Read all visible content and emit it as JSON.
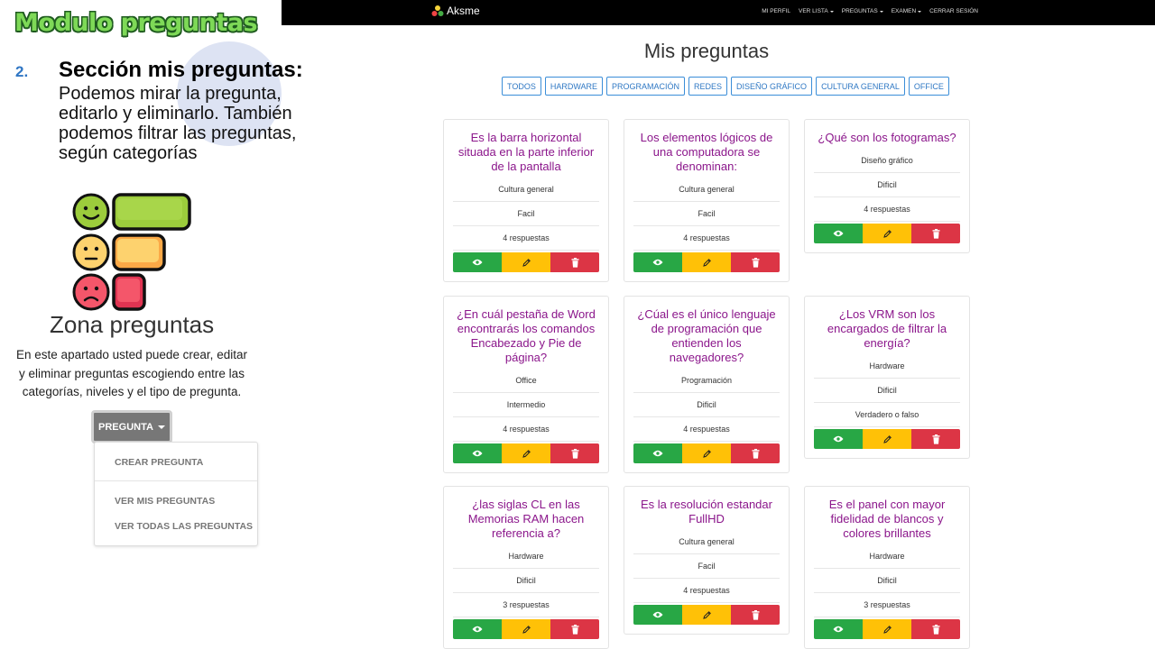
{
  "slide": {
    "title": "Modulo preguntas",
    "section_number": "2.",
    "section_heading": "Sección mis preguntas:",
    "section_description": "Podemos mirar la pregunta, editarlo y eliminarlo. También podemos filtrar las preguntas, según categorías"
  },
  "zona": {
    "title": "Zona preguntas",
    "description": "En este apartado usted puede crear, editar y eliminar preguntas escogiendo entre las categorías, niveles y el tipo de pregunta.",
    "button_label": "PREGUNTA",
    "menu": [
      "CREAR PREGUNTA",
      "VER MIS PREGUNTAS",
      "VER TODAS LAS PREGUNTAS"
    ]
  },
  "navbar": {
    "brand": "Aksme",
    "items": [
      "MI PERFIL",
      "VER LISTA",
      "PREGUNTAS",
      "EXAMEN",
      "CERRAR SESIÓN"
    ]
  },
  "page": {
    "title": "Mis preguntas",
    "filters": [
      "TODOS",
      "HARDWARE",
      "PROGRAMACIÓN",
      "REDES",
      "DISEÑO GRÁFICO",
      "CULTURA GENERAL",
      "OFFICE"
    ]
  },
  "cards": [
    {
      "question": "Es la barra horizontal situada en la parte inferior de la pantalla",
      "category": "Cultura general",
      "level": "Facil",
      "extra": "4 respuestas"
    },
    {
      "question": "Los elementos lógicos de una computadora se denominan:",
      "category": "Cultura general",
      "level": "Facil",
      "extra": "4 respuestas"
    },
    {
      "question": "¿Qué son los fotogramas?",
      "category": "Diseño gráfico",
      "level": "Dificil",
      "extra": "4 respuestas"
    },
    {
      "question": "¿En cuál pestaña de Word encontrarás los comandos Encabezado y Pie de página?",
      "category": "Office",
      "level": "Intermedio",
      "extra": "4 respuestas"
    },
    {
      "question": "¿Cúal es el único lenguaje de programación que entienden los navegadores?",
      "category": "Programación",
      "level": "Dificil",
      "extra": "4 respuestas"
    },
    {
      "question": "¿Los VRM son los encargados de filtrar la energía?",
      "category": "Hardware",
      "level": "Dificil",
      "extra": "Verdadero o falso"
    },
    {
      "question": "¿las siglas CL en las Memorias RAM hacen referencia a?",
      "category": "Hardware",
      "level": "Dificil",
      "extra": "3 respuestas"
    },
    {
      "question": "Es la resolución estandar FullHD",
      "category": "Cultura general",
      "level": "Facil",
      "extra": "4 respuestas"
    },
    {
      "question": "Es el panel con mayor fidelidad de blancos y colores brillantes",
      "category": "Hardware",
      "level": "Dificil",
      "extra": "3 respuestas"
    }
  ],
  "colors": {
    "question_text": "#8b168b",
    "view_button": "#28a745",
    "edit_button": "#ffc107",
    "delete_button": "#dc3545",
    "filter_border": "#3b8ed8"
  }
}
